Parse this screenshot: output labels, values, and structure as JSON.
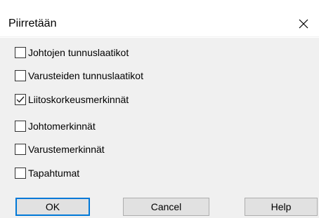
{
  "window": {
    "title": "Piirretään",
    "close_icon": "close-icon"
  },
  "options": [
    {
      "label": "Johtojen tunnuslaatikot",
      "checked": false
    },
    {
      "label": "Varusteiden tunnuslaatikot",
      "checked": false
    },
    {
      "label": "Liitoskorkeusmerkinnät",
      "checked": true
    },
    {
      "label": "Johtomerkinnät",
      "checked": false
    },
    {
      "label": "Varustemerkinnät",
      "checked": false
    },
    {
      "label": "Tapahtumat",
      "checked": false
    }
  ],
  "buttons": {
    "ok": "OK",
    "cancel": "Cancel",
    "help": "Help"
  },
  "colors": {
    "dialog_background": "#f0f0f0",
    "title_background": "#ffffff",
    "default_button_border": "#0078d7",
    "button_face": "#e1e1e1"
  }
}
